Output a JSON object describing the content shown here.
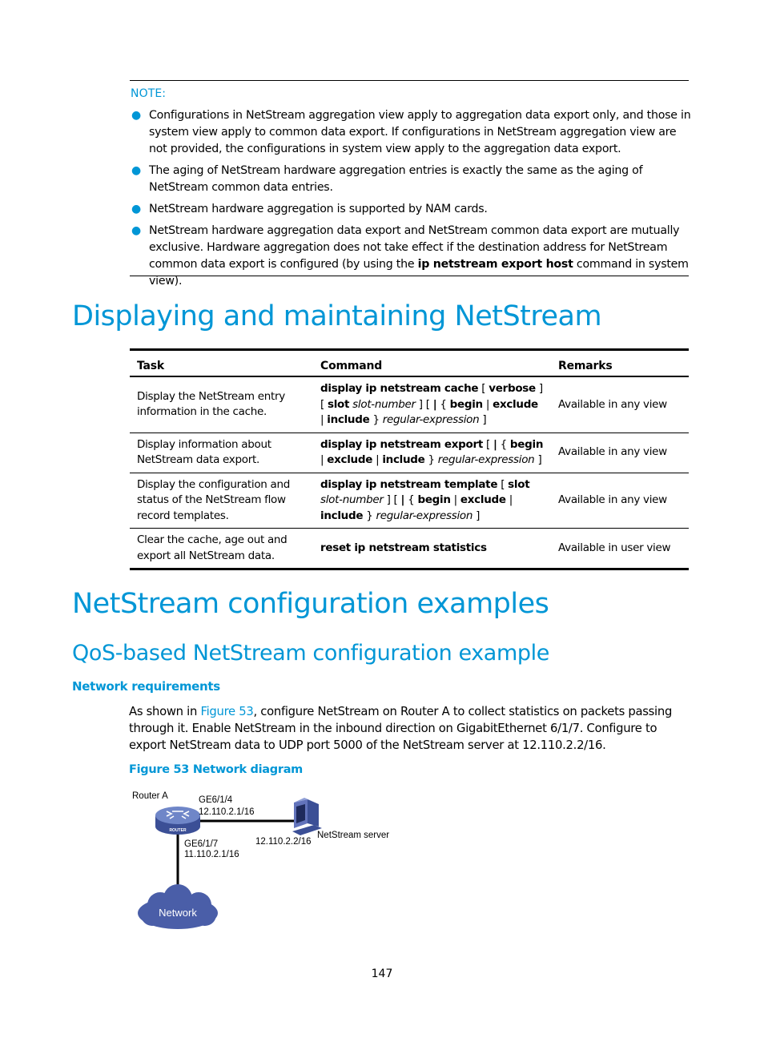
{
  "note": {
    "label": "NOTE:",
    "items": [
      {
        "text": "Configurations in NetStream aggregation view apply to aggregation data export only, and those in system view apply to common data export. If configurations in NetStream aggregation view are not provided, the configurations in system view apply to the aggregation data export."
      },
      {
        "text": "The aging of NetStream hardware aggregation entries is exactly the same as the aging of NetStream common data entries."
      },
      {
        "text": "NetStream hardware aggregation is supported by NAM cards."
      },
      {
        "text_before": "NetStream hardware aggregation data export and NetStream common data export are mutually exclusive. Hardware aggregation does not take effect if the destination address for NetStream common data export is configured (by using the ",
        "bold": "ip netstream export host",
        "text_after": " command in system view)."
      }
    ]
  },
  "section1": {
    "title": "Displaying and maintaining NetStream",
    "table": {
      "headers": [
        "Task",
        "Command",
        "Remarks"
      ],
      "rows": [
        {
          "task": "Display the NetStream entry information in the cache.",
          "command": [
            {
              "t": "display ip netstream cache",
              "s": "b"
            },
            {
              "t": " [ ",
              "s": ""
            },
            {
              "t": "verbose",
              "s": "b"
            },
            {
              "t": " ] [ ",
              "s": ""
            },
            {
              "t": "slot",
              "s": "b"
            },
            {
              "t": " ",
              "s": ""
            },
            {
              "t": "slot-number",
              "s": "i"
            },
            {
              "t": " ] [ ",
              "s": ""
            },
            {
              "t": "|",
              "s": "b"
            },
            {
              "t": " { ",
              "s": ""
            },
            {
              "t": "begin",
              "s": "b"
            },
            {
              "t": " | ",
              "s": ""
            },
            {
              "t": "exclude",
              "s": "b"
            },
            {
              "t": " | ",
              "s": ""
            },
            {
              "t": "include",
              "s": "b"
            },
            {
              "t": " } ",
              "s": ""
            },
            {
              "t": "regular-expression",
              "s": "i"
            },
            {
              "t": " ]",
              "s": ""
            }
          ],
          "remarks": "Available in any view"
        },
        {
          "task": "Display information about NetStream data export.",
          "command": [
            {
              "t": "display ip netstream export",
              "s": "b"
            },
            {
              "t": " [ ",
              "s": ""
            },
            {
              "t": "|",
              "s": "b"
            },
            {
              "t": " { ",
              "s": ""
            },
            {
              "t": "begin",
              "s": "b"
            },
            {
              "t": " | ",
              "s": ""
            },
            {
              "t": "exclude",
              "s": "b"
            },
            {
              "t": " | ",
              "s": ""
            },
            {
              "t": "include",
              "s": "b"
            },
            {
              "t": " } ",
              "s": ""
            },
            {
              "t": "regular-expression",
              "s": "i"
            },
            {
              "t": " ]",
              "s": ""
            }
          ],
          "remarks": "Available in any view"
        },
        {
          "task": "Display the configuration and status of the NetStream flow record templates.",
          "command": [
            {
              "t": "display ip netstream template",
              "s": "b"
            },
            {
              "t": " [ ",
              "s": ""
            },
            {
              "t": "slot",
              "s": "b"
            },
            {
              "t": " ",
              "s": ""
            },
            {
              "t": "slot-number",
              "s": "i"
            },
            {
              "t": " ] [ ",
              "s": ""
            },
            {
              "t": "|",
              "s": "b"
            },
            {
              "t": " { ",
              "s": ""
            },
            {
              "t": "begin",
              "s": "b"
            },
            {
              "t": " | ",
              "s": ""
            },
            {
              "t": "exclude",
              "s": "b"
            },
            {
              "t": " | ",
              "s": ""
            },
            {
              "t": "include",
              "s": "b"
            },
            {
              "t": " } ",
              "s": ""
            },
            {
              "t": "regular-expression",
              "s": "i"
            },
            {
              "t": " ]",
              "s": ""
            }
          ],
          "remarks": "Available in any view"
        },
        {
          "task": "Clear the cache, age out and export all NetStream data.",
          "command": [
            {
              "t": "reset ip netstream statistics",
              "s": "b"
            }
          ],
          "remarks": "Available in user view"
        }
      ]
    }
  },
  "section2": {
    "title": "NetStream configuration examples",
    "subsection": {
      "title": "QoS-based NetStream configuration example",
      "heading": "Network requirements",
      "para": {
        "before": "As shown in ",
        "link": "Figure 53",
        "after": ", configure NetStream on Router A to collect statistics on packets passing through it. Enable NetStream in the inbound direction on GigabitEthernet 6/1/7. Configure to export NetStream data to UDP port 5000 of the NetStream server at 12.110.2.2/16."
      },
      "figure_caption": "Figure 53 Network diagram",
      "diagram": {
        "router_label": "Router A",
        "router_badge": "ROUTER",
        "if_up_name": "GE6/1/4",
        "if_up_ip": "12.110.2.1/16",
        "if_down_name": "GE6/1/7",
        "if_down_ip": "11.110.2.1/16",
        "server_ip": "12.110.2.2/16",
        "server_label": "NetStream server",
        "cloud_label": "Network"
      }
    }
  },
  "page_number": "147",
  "colors": {
    "accent": "#0096d6",
    "device_blue": "#4a5ea8"
  }
}
